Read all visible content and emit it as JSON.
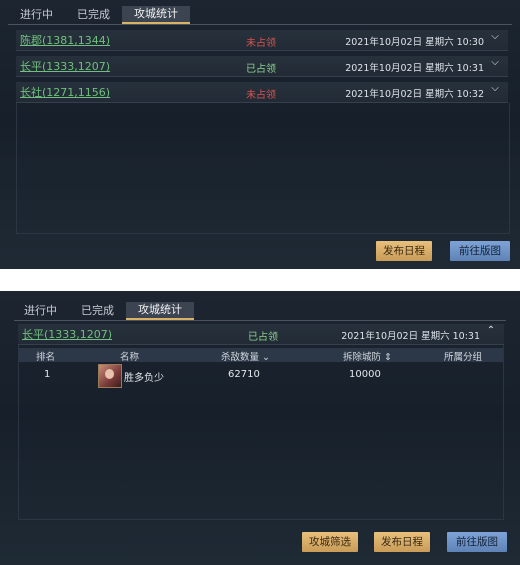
{
  "panel1": {
    "tabs": [
      {
        "label": "进行中"
      },
      {
        "label": "已完成"
      },
      {
        "label": "攻城统计"
      }
    ],
    "rows": [
      {
        "city": "陈郡(1381,1344)",
        "status": "未占领",
        "time": "2021年10月02日 星期六 10:30"
      },
      {
        "city": "长平(1333,1207)",
        "status": "已占领",
        "time": "2021年10月02日 星期六 10:31"
      },
      {
        "city": "长社(1271,1156)",
        "status": "未占领",
        "time": "2021年10月02日 星期六 10:32"
      }
    ],
    "buttons": {
      "publish": "发布日程",
      "goto_map": "前往版图"
    }
  },
  "panel2": {
    "tabs": [
      {
        "label": "进行中"
      },
      {
        "label": "已完成"
      },
      {
        "label": "攻城统计"
      }
    ],
    "row": {
      "city": "长平(1333,1207)",
      "status": "已占领",
      "time": "2021年10月02日 星期六 10:31"
    },
    "table": {
      "headers": {
        "rank": "排名",
        "name": "名称",
        "kills": "杀敌数量",
        "demolish": "拆除城防",
        "group": "所属分组"
      },
      "rows": [
        {
          "rank": "1",
          "name": "胜多负少",
          "kills": "62710",
          "demolish": "10000",
          "group": ""
        }
      ]
    },
    "buttons": {
      "filter": "攻城筛选",
      "publish": "发布日程",
      "goto_map": "前往版图"
    }
  },
  "colors": {
    "gold": "#d9b266",
    "green": "#6fc07e",
    "red": "#d9534f",
    "blue": "#6f94c9"
  }
}
